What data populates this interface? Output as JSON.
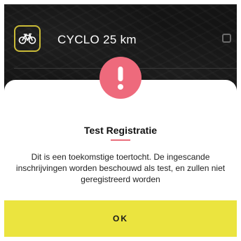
{
  "route_list": {
    "item": {
      "icon": "bicycle-icon",
      "label": "CYCLO 25 km",
      "checked": false
    }
  },
  "dialog": {
    "icon": "exclamation-icon",
    "title": "Test Registratie",
    "message": "Dit is een toekomstige toertocht. De ingescande inschrijvingen worden beschouwd als test, en zullen niet geregistreerd worden",
    "ok_label": "OK"
  },
  "colors": {
    "background_dark": "#141414",
    "accent_yellow": "#c9ba37",
    "button_yellow": "#ebe43f",
    "alert_pink": "#ee6a7c"
  }
}
